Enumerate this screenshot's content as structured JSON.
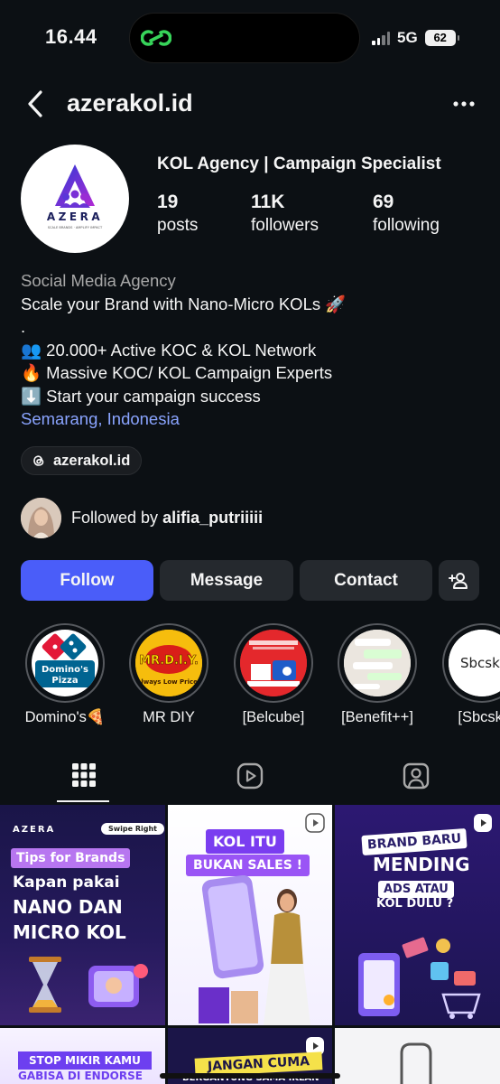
{
  "status_bar": {
    "time": "16.44",
    "network": "5G",
    "battery": "62"
  },
  "header": {
    "username": "azerakol.id"
  },
  "profile": {
    "logo_name": "AZERA",
    "logo_tagline": "SCALE BRANDS · AMPLIFY IMPACT",
    "full_name": "KOL Agency | Campaign Specialist",
    "posts_count": "19",
    "posts_label": "posts",
    "followers_count": "11K",
    "followers_label": "followers",
    "following_count": "69",
    "following_label": "following"
  },
  "bio": {
    "category": "Social Media Agency",
    "line1": "Scale your Brand with Nano-Micro KOLs 🚀",
    "line2": ".",
    "line3": "👥 20.000+ Active KOC & KOL Network",
    "line4": "🔥 Massive KOC/ KOL Campaign Experts",
    "line5": "⬇️ Start your campaign success",
    "location": "Semarang, Indonesia"
  },
  "threads_link": "azerakol.id",
  "followed_by": {
    "prefix": "Followed by ",
    "user": "alifia_putriiiii"
  },
  "buttons": {
    "follow": "Follow",
    "message": "Message",
    "contact": "Contact"
  },
  "highlights": [
    {
      "label": "Domino's🍕",
      "img_text": "Domino's Pizza"
    },
    {
      "label": "MR DIY",
      "img_text": "MR.D.I.Y.",
      "img_sub": "Always Low Prices"
    },
    {
      "label": "[Belcube]",
      "img_text": "THE LAUGHING COW"
    },
    {
      "label": "[Benefit++]"
    },
    {
      "label": "[Sbcski",
      "img_text": "Sbcski"
    }
  ],
  "posts": [
    {
      "brand": "AZERA",
      "badge": "Swipe Right",
      "tag": "Tips for Brands",
      "line1": "Kapan pakai",
      "line2": "NANO DAN",
      "line3": "MICRO KOL"
    },
    {
      "line1": "KOL ITU",
      "line2": "BUKAN SALES !"
    },
    {
      "line1": "BRAND BARU",
      "line2": "MENDING",
      "line3": "ADS ATAU",
      "line4": "KOL DULU ?"
    },
    {
      "line1": "STOP MIKIR KAMU",
      "line2": "GABISA DI ENDORSE"
    },
    {
      "line1": "JANGAN CUMA",
      "line2": "BERGANTUNG SAMA IKLAN"
    },
    {}
  ],
  "colors": {
    "background": "#0c1014",
    "accent": "#4a5df9",
    "button": "#25292e",
    "link": "#8aa4ff"
  },
  "icons": [
    "back-arrow-icon",
    "more-icon",
    "threads-icon",
    "add-person-icon",
    "grid-icon",
    "reels-icon",
    "tagged-icon",
    "reel-badge-icon"
  ]
}
